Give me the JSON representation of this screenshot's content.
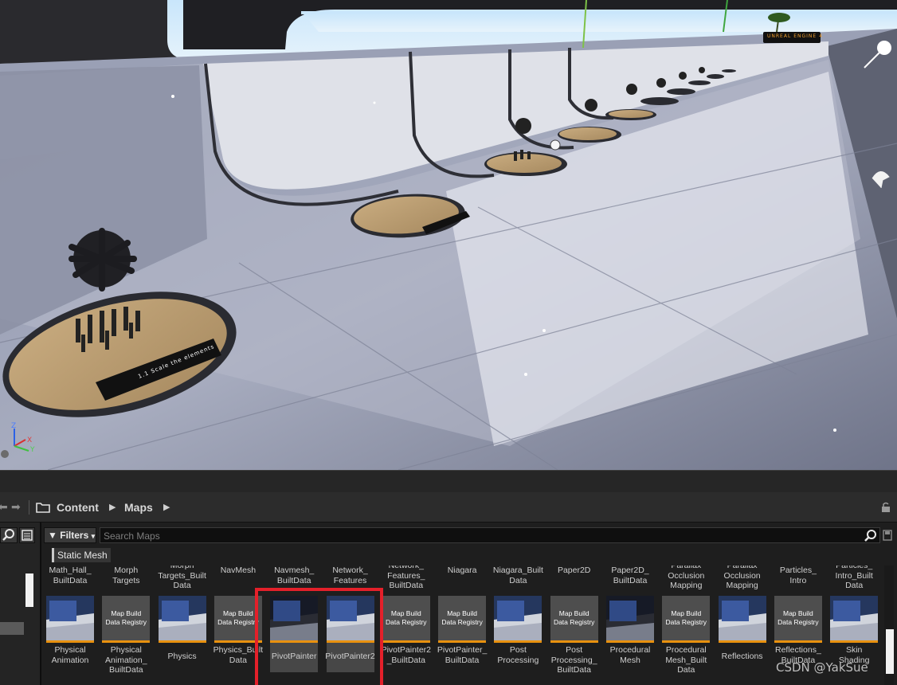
{
  "viewport": {
    "sign_text": "UNREAL ENGINE 4",
    "plaque_text": "1.1 Scale the elements",
    "axis": {
      "x": "X",
      "y": "Y",
      "z": "Z"
    }
  },
  "content_browser": {
    "path": {
      "root": "Content",
      "folder": "Maps"
    },
    "filters_label": "Filters",
    "search_placeholder": "Search Maps",
    "active_filter": "Static Mesh",
    "top_row_labels": [
      "Math_Hall_\nBuiltData",
      "Morph\nTargets",
      "Morph\nTargets_Built\nData",
      "NavMesh",
      "Navmesh_\nBuiltData",
      "Network_\nFeatures",
      "Network_\nFeatures_\nBuiltData",
      "Niagara",
      "Niagara_Built\nData",
      "Paper2D",
      "Paper2D_\nBuiltData",
      "Parallax\nOcclusion\nMapping",
      "Parallax\nOcclusion\nMapping",
      "Particles_\nIntro",
      "Particles_\nIntro_Built\nData"
    ],
    "assets": [
      {
        "name": "Physical\nAnimation",
        "kind": "map"
      },
      {
        "name": "Physical\nAnimation_\nBuiltData",
        "kind": "registry"
      },
      {
        "name": "Physics",
        "kind": "map"
      },
      {
        "name": "Physics_Built\nData",
        "kind": "registry"
      },
      {
        "name": "PivotPainter",
        "kind": "map_dark"
      },
      {
        "name": "PivotPainter2",
        "kind": "map"
      },
      {
        "name": "PivotPainter2\n_BuiltData",
        "kind": "registry"
      },
      {
        "name": "PivotPainter_\nBuiltData",
        "kind": "registry"
      },
      {
        "name": "Post\nProcessing",
        "kind": "map"
      },
      {
        "name": "Post\nProcessing_\nBuiltData",
        "kind": "registry"
      },
      {
        "name": "Procedural\nMesh",
        "kind": "map_dark"
      },
      {
        "name": "Procedural\nMesh_Built\nData",
        "kind": "registry"
      },
      {
        "name": "Reflections",
        "kind": "map"
      },
      {
        "name": "Reflections_\nBuiltData",
        "kind": "registry"
      },
      {
        "name": "Skin\nShading",
        "kind": "map"
      }
    ],
    "registry_text": "Map Build\nData Registry",
    "selected": [
      "PivotPainter",
      "PivotPainter2"
    ]
  },
  "watermark": "CSDN @YakSue",
  "colors": {
    "asset_bar": "#e8910f",
    "highlight": "#e4202a",
    "panel": "#1e1e1e"
  }
}
